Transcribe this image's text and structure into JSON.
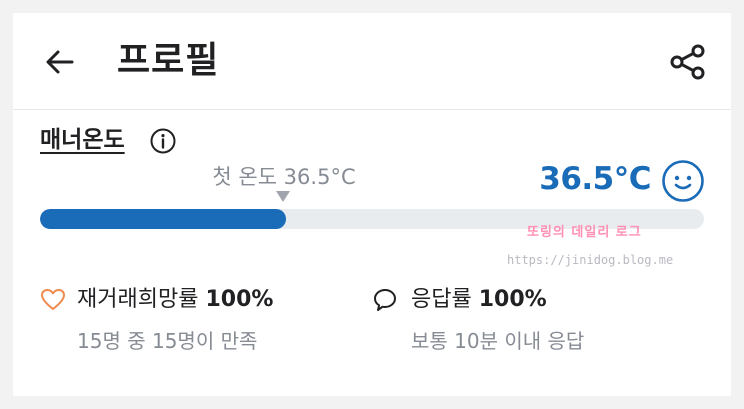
{
  "header": {
    "title": "프로필",
    "back_icon": "arrow-left-icon",
    "share_icon": "share-icon"
  },
  "manner": {
    "title": "매너온도",
    "info_icon": "info-icon",
    "first_temp_label": "첫 온도 36.5°C",
    "current_temp": "36.5°C",
    "face_icon": "smile-face-icon",
    "bar_fill_fraction": 0.37,
    "accent_color": "#1a6bb8"
  },
  "watermark": {
    "text": "또링의 데일리 로그",
    "url": "https://jinidog.blog.me"
  },
  "stats": {
    "rebuy": {
      "icon": "heart-icon",
      "label": "재거래희망률",
      "value": "100%",
      "sub": "15명 중 15명이 만족"
    },
    "response": {
      "icon": "chat-bubble-icon",
      "label": "응답률",
      "value": "100%",
      "sub": "보통 10분 이내 응답"
    }
  }
}
